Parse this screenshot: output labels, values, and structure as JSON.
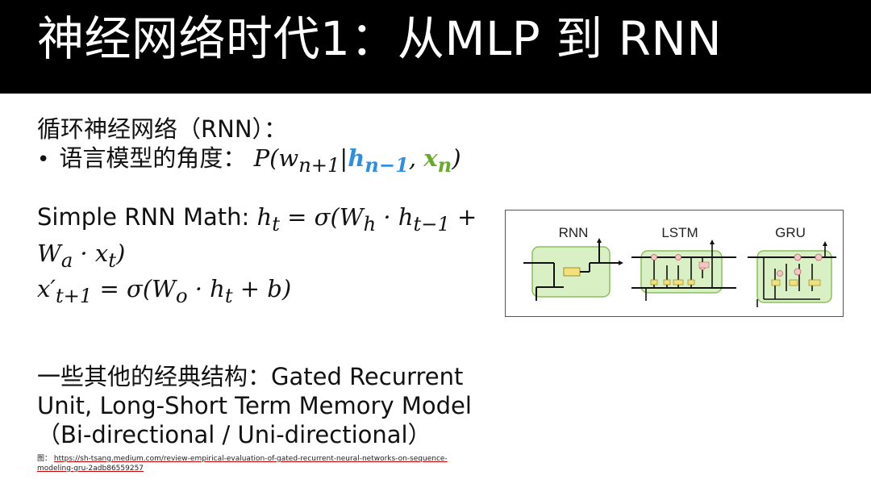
{
  "header": {
    "title": "神经网络时代1：从MLP 到 RNN"
  },
  "body": {
    "heading": "循环神经网络（RNN）：",
    "bullet_prefix": "语言模型的角度：",
    "bullet_formula_a": "P(w",
    "bullet_formula_sub": "n+1",
    "bullet_formula_bar": "|",
    "bullet_formula_h": "h",
    "bullet_formula_h_sub": "n−1",
    "bullet_formula_comma": ", ",
    "bullet_formula_x": "x",
    "bullet_formula_x_sub": "n",
    "bullet_formula_close": ")",
    "rnn_math_label": "Simple RNN Math: ",
    "rnn_math_eq1_part1": "h",
    "rnn_math_eq1_part1_sub": "t",
    "rnn_math_eq1_part2": " = σ(W",
    "rnn_math_eq1_part2_sub": "h",
    "rnn_math_eq1_part3": " · h",
    "rnn_math_eq1_part3_sub": "t−1",
    "rnn_math_eq1_part4": " +",
    "rnn_math_eq1_line2a": "W",
    "rnn_math_eq1_line2a_sub": "a",
    "rnn_math_eq1_line2b": " · x",
    "rnn_math_eq1_line2b_sub": "t",
    "rnn_math_eq1_line2c": ")",
    "rnn_math_eq2a": "x′",
    "rnn_math_eq2a_sub": "t+1",
    "rnn_math_eq2b": " = σ(W",
    "rnn_math_eq2b_sub": "o",
    "rnn_math_eq2c": " · h",
    "rnn_math_eq2c_sub": "t",
    "rnn_math_eq2d": " + b)",
    "structures_line1": "一些其他的经典结构：Gated Recurrent",
    "structures_line2": "Unit, Long-Short Term Memory Model",
    "structures_line3": "（Bi-directional / Uni-directional）"
  },
  "source": {
    "prefix": "图：",
    "url_line1": "https://sh-tsang.medium.com/review-empirical-evaluation-of-gated-recurrent-neural-networks-on-sequence-",
    "url_line2": "modeling-gru-2adb86559257"
  },
  "diagram": {
    "labels": [
      "RNN",
      "LSTM",
      "GRU"
    ],
    "cell_color": "#d9efc4",
    "cell_border": "#8cbf5f",
    "gate_color": "#f4c7c7",
    "box_color": "#f3e07a"
  }
}
